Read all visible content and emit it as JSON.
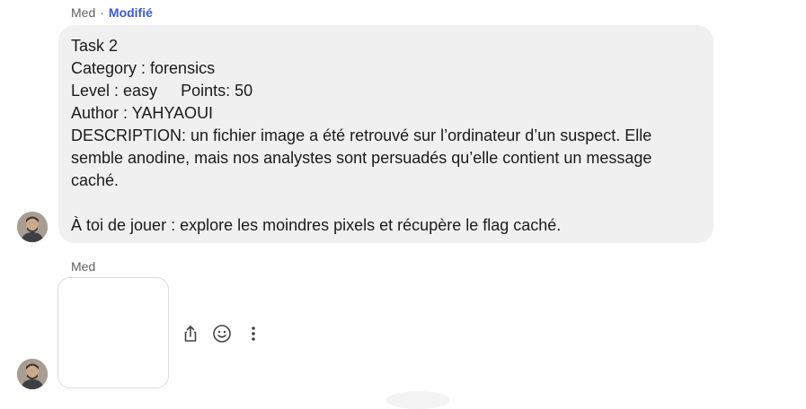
{
  "message1": {
    "sender": "Med",
    "separator": "·",
    "edited_label": "Modifié",
    "lines": {
      "task": "Task 2",
      "category": "Category : forensics",
      "level": "Level : easy",
      "points": "Points: 50",
      "author": "Author : YAHYAOUI",
      "description": "DESCRIPTION: un fichier image a été retrouvé sur l’ordinateur d’un suspect. Elle semble anodine, mais nos analystes sont persuadés qu’elle contient un message caché.",
      "call_to_action": "À toi de jouer : explore les moindres pixels et récupère le flag caché."
    }
  },
  "message2": {
    "sender": "Med"
  },
  "icons": {
    "share": "share-icon",
    "emoji": "emoji-icon",
    "more": "more-vert-icon"
  },
  "colors": {
    "bubble_bg": "#f0f0f0",
    "edited": "#3b5bdb",
    "meta_text": "#616161"
  }
}
